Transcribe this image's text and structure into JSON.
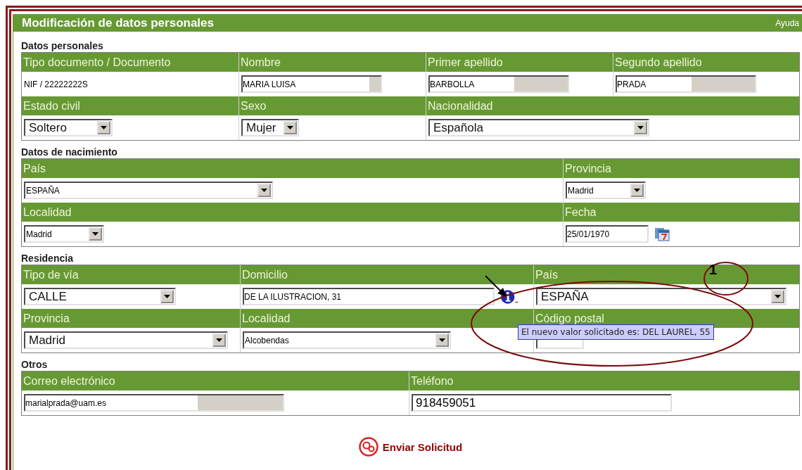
{
  "panel": {
    "title": "Modificación de datos personales",
    "help_link": "Ayuda"
  },
  "sections": [
    {
      "title": "Datos personales",
      "rows": [
        {
          "cells": [
            {
              "label": "Tipo documento / Documento",
              "field": {
                "kind": "plain",
                "value": "NIF / 22222222S"
              }
            },
            {
              "label": "Nombre",
              "field": {
                "kind": "locked-input",
                "value": "MARIA LUISA"
              }
            },
            {
              "label": "Primer apellido",
              "field": {
                "kind": "locked-input",
                "value": "BARBOLLA"
              }
            },
            {
              "label": "Segundo apellido",
              "field": {
                "kind": "locked-input",
                "value": "PRADA"
              }
            }
          ]
        },
        {
          "cells": [
            {
              "label": "Estado civil",
              "field": {
                "kind": "select",
                "value": "Soltero"
              }
            },
            {
              "label": "Sexo",
              "field": {
                "kind": "select",
                "value": "Mujer"
              }
            },
            {
              "label": "Nacionalidad",
              "field": {
                "kind": "select",
                "value": "Española"
              }
            }
          ]
        }
      ]
    },
    {
      "title": "Datos de nacimiento",
      "rows": [
        {
          "cells": [
            {
              "label": "País",
              "field": {
                "kind": "compact-select",
                "value": "ESPAÑA"
              }
            },
            {
              "label": "Provincia",
              "field": {
                "kind": "compact-select",
                "value": "Madrid"
              }
            }
          ]
        },
        {
          "cells": [
            {
              "label": "Localidad",
              "field": {
                "kind": "compact-select",
                "value": "Madrid"
              }
            },
            {
              "label": "Fecha",
              "field": {
                "kind": "date",
                "value": "25/01/1970"
              }
            }
          ]
        }
      ]
    },
    {
      "title": "Residencia",
      "rows": [
        {
          "cells": [
            {
              "label": "Tipo de vía",
              "field": {
                "kind": "select",
                "value": "CALLE"
              }
            },
            {
              "label": "Domicilio",
              "field": {
                "kind": "compact-input",
                "value": "DE LA ILUSTRACION, 31"
              },
              "info": {
                "tooltip": "El nuevo valor solicitado es: DEL LAUREL, 55"
              }
            },
            {
              "label": "País",
              "field": {
                "kind": "select",
                "value": "ESPAÑA"
              }
            }
          ]
        },
        {
          "cells": [
            {
              "label": "Provincia",
              "field": {
                "kind": "select",
                "value": "Madrid"
              }
            },
            {
              "label": "Localidad",
              "field": {
                "kind": "compact-select",
                "value": "Alcobendas"
              }
            },
            {
              "label": "Código postal",
              "field": {
                "kind": "compact-input"
              }
            }
          ]
        }
      ]
    },
    {
      "title": "Otros",
      "rows": [
        {
          "cells": [
            {
              "label": "Correo electrónico",
              "field": {
                "kind": "locked-input",
                "value": "marialprada@uam.es"
              }
            },
            {
              "label": "Teléfono",
              "field": {
                "kind": "input",
                "value": "918459051"
              }
            }
          ]
        }
      ]
    }
  ],
  "submit_button": "Enviar Solicitud",
  "annotation": {
    "marker": "1"
  }
}
